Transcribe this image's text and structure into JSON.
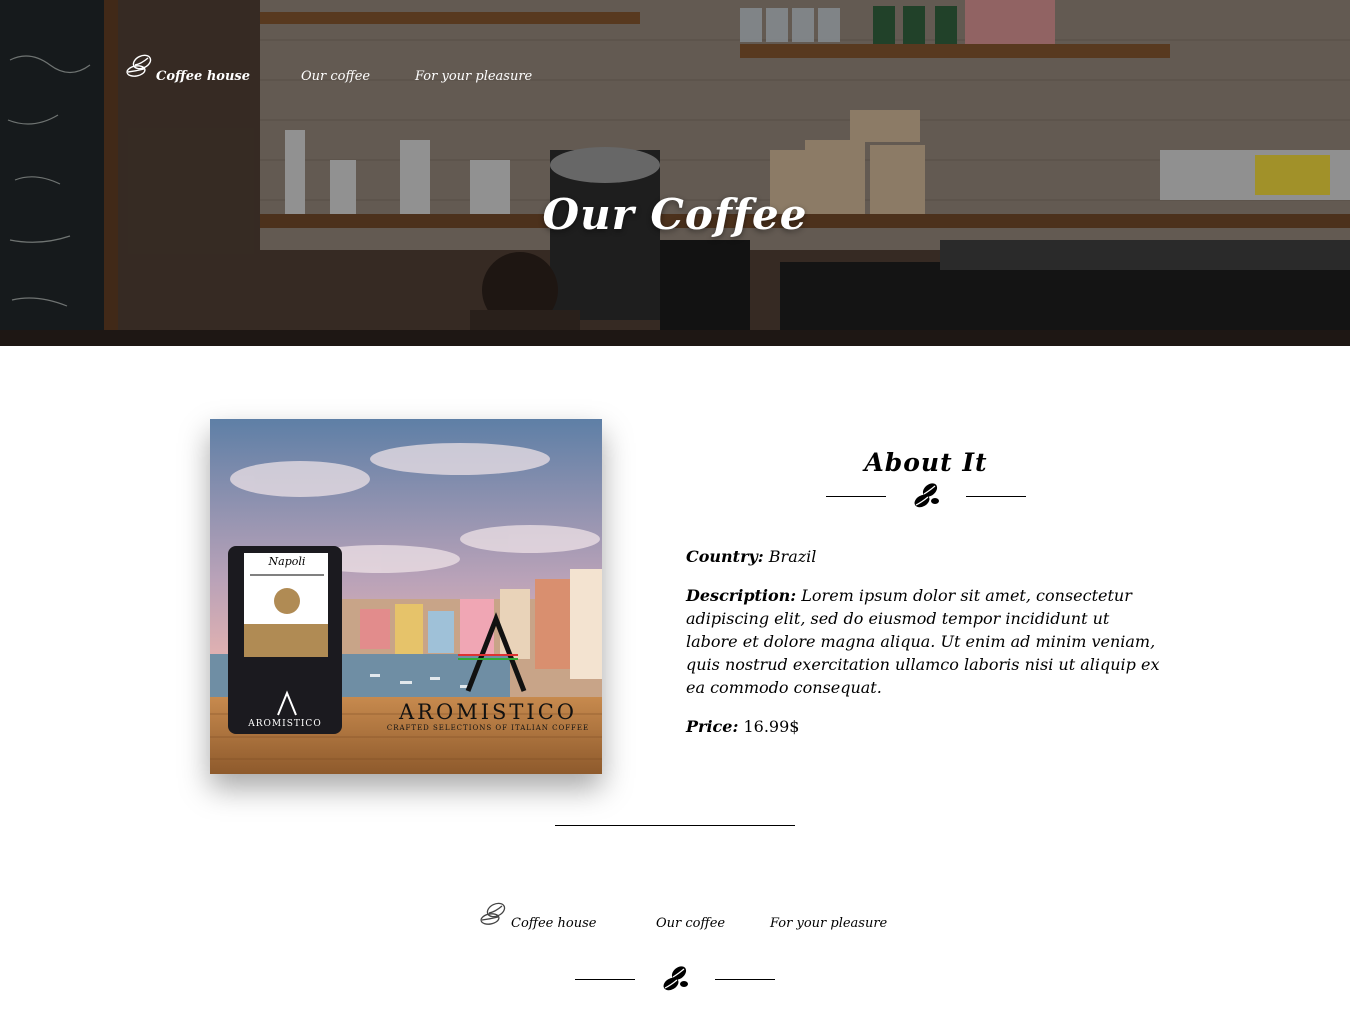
{
  "header": {
    "nav": {
      "logo_icon": "coffee-beans-icon",
      "home_label": "Coffee house",
      "coffee_label": "Our coffee",
      "pleasure_label": "For your pleasure"
    },
    "title": "Our Coffee"
  },
  "product": {
    "image": {
      "bag_name": "Napoli",
      "brand": "AROMISTICO",
      "tagline": "CRAFTED SELECTIONS OF ITALIAN COFFEE"
    },
    "about_title": "About It",
    "divider_icon": "coffee-beans-icon",
    "country_label": "Country:",
    "country_value": "Brazil",
    "description_label": "Description:",
    "description_value": "Lorem ipsum dolor sit amet, consectetur adipiscing elit, sed do eiusmod tempor incididunt ut labore et dolore magna aliqua. Ut enim ad minim veniam, quis nostrud exercitation ullamco laboris nisi ut aliquip ex ea commodo consequat.",
    "price_label": "Price:",
    "price_value": "16.99$"
  },
  "footer": {
    "nav": {
      "logo_icon": "coffee-beans-icon",
      "home_label": "Coffee house",
      "coffee_label": "Our coffee",
      "pleasure_label": "For your pleasure"
    },
    "divider_icon": "coffee-beans-icon"
  },
  "colors": {
    "text": "#000000",
    "hero_text": "#ffffff",
    "background": "#ffffff"
  }
}
